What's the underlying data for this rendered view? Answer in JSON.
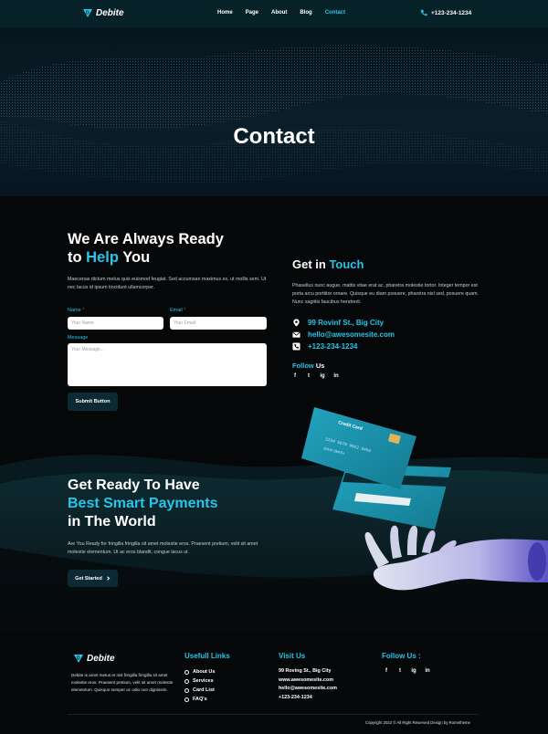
{
  "brand": {
    "name": "Debite",
    "accent": "#26c6e8"
  },
  "nav": {
    "items": [
      "Home",
      "Page",
      "About",
      "Blog",
      "Contact"
    ],
    "active": "Contact",
    "phone": "+123-234-1234",
    "phone_icon": "phone-icon"
  },
  "hero": {
    "title": "Contact"
  },
  "contact_form": {
    "heading_line1": "We Are Always Ready",
    "heading_line2_prefix": "to ",
    "heading_line2_accent": "Help",
    "heading_line2_suffix": " You",
    "description": "Maecenas dictum metus quis euismod feugiat. Sed accumsan maximus ex, ut mollis sem. Ut nec lacus id ipsum tincidunt ullamcorper.",
    "name_label": "Name",
    "name_placeholder": "Your Name",
    "email_label": "Email",
    "email_placeholder": "Your Email",
    "message_label": "Message",
    "message_placeholder": "Your Message...",
    "required_mark": "*",
    "submit_label": "Submit Button"
  },
  "get_in_touch": {
    "heading_prefix": "Get in ",
    "heading_accent": "Touch",
    "description": "Phasellus nunc augue, mattis vitae erat ac, pharetra molestie tortor. Integer tempor est porta arcu porttitor ornare. Quisque eu diam posuere, pharetra nisl sed, posuere quam. Nunc sagittis faucibus hendrerit.",
    "address": "99 Rovinf St., Big City",
    "email": "hello@awesomesite.com",
    "phone": "+123-234-1234",
    "follow_prefix": "Follow ",
    "follow_suffix": "Us",
    "social": [
      "f",
      "t",
      "ig",
      "in"
    ]
  },
  "cta": {
    "line1": "Get Ready To Have",
    "line2": "Best Smart Payments",
    "line3": "in The World",
    "description": "Are You Ready for fringilla fringilla sit amet molestie eros. Praesent pretium, velit sit amet molestie elementum.  Ut ac eros blandit, congue lacus ut.",
    "button_label": "Get Started",
    "button_icon": "chevron-right-icon",
    "card_title": "Credit Card",
    "card_number": "1234 5678 9012 3456",
    "card_holder": "JOHN SMITH"
  },
  "footer": {
    "about": "Debite is amet metus et nisl fringilla fringilla sit amet molestie eros. Praesent pretium, velit sit amet molestie elementum. Quisque semper ac odio non dignissim.",
    "useful_links_title": "Usefull Links",
    "useful_links": [
      "About Us",
      "Services",
      "Card List",
      "FAQ's"
    ],
    "visit_title": "Visit Us",
    "visit": [
      "99 Roving St., Big City",
      "www.awesomesite.com",
      "hello@awesomesite.com",
      "+123-234-1234"
    ],
    "follow_title": "Follow Us :",
    "copyright": "Copyright 2022 © All Right Reserved Design by Rometheme"
  }
}
